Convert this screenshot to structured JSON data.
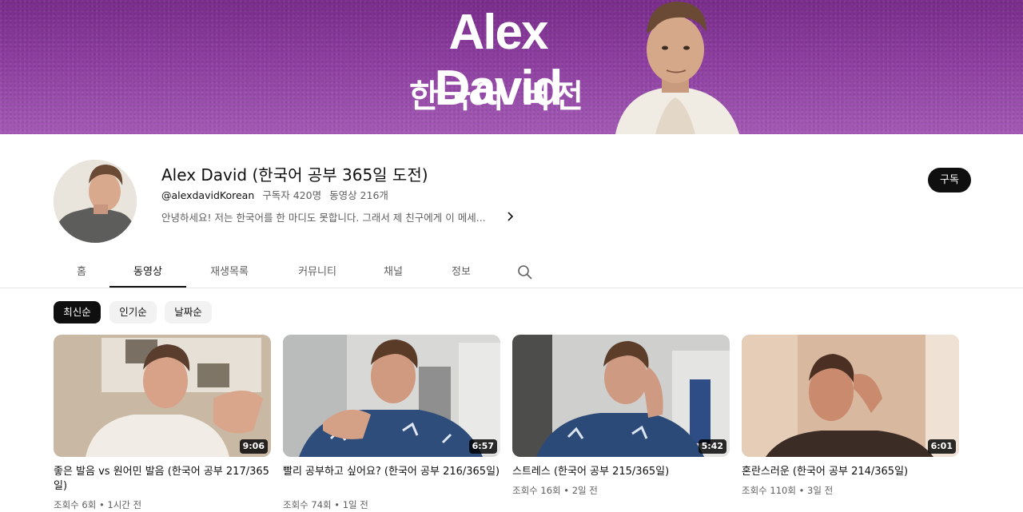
{
  "banner": {
    "title": "Alex David",
    "subtitle": "한국어 버전"
  },
  "channel": {
    "name": "Alex David (한국어 공부 365일 도전)",
    "handle": "@alexdavidKorean",
    "subscribers": "구독자 420명",
    "videos_count": "동영상 216개",
    "description": "안녕하세요! 저는 한국어를 한 마디도 못합니다. 그래서 제 친구에게 이 메세...",
    "subscribe_label": "구독"
  },
  "tabs": [
    {
      "label": "홈"
    },
    {
      "label": "동영상"
    },
    {
      "label": "재생목록"
    },
    {
      "label": "커뮤니티"
    },
    {
      "label": "채널"
    },
    {
      "label": "정보"
    }
  ],
  "chips": [
    {
      "label": "최신순"
    },
    {
      "label": "인기순"
    },
    {
      "label": "날짜순"
    }
  ],
  "videos": [
    {
      "title": "좋은 발음 vs 원어민 발음 (한국어 공부 217/365일)",
      "views": "조회수 6회",
      "age": "1시간 전",
      "duration": "9:06"
    },
    {
      "title": "빨리 공부하고 싶어요? (한국어 공부 216/365일)",
      "views": "조회수 74회",
      "age": "1일 전",
      "duration": "6:57"
    },
    {
      "title": "스트레스 (한국어 공부 215/365일)",
      "views": "조회수 16회",
      "age": "2일 전",
      "duration": "5:42"
    },
    {
      "title": "혼란스러운 (한국어 공부 214/365일)",
      "views": "조회수 110회",
      "age": "3일 전",
      "duration": "6:01"
    }
  ],
  "colors": {
    "banner_purple": "#8e3fa1",
    "text_primary": "#0f0f0f",
    "text_secondary": "#606060",
    "chip_bg": "#f2f2f2"
  },
  "icons": {
    "description_more": "chevron-right-icon",
    "tab_search": "search-icon"
  }
}
